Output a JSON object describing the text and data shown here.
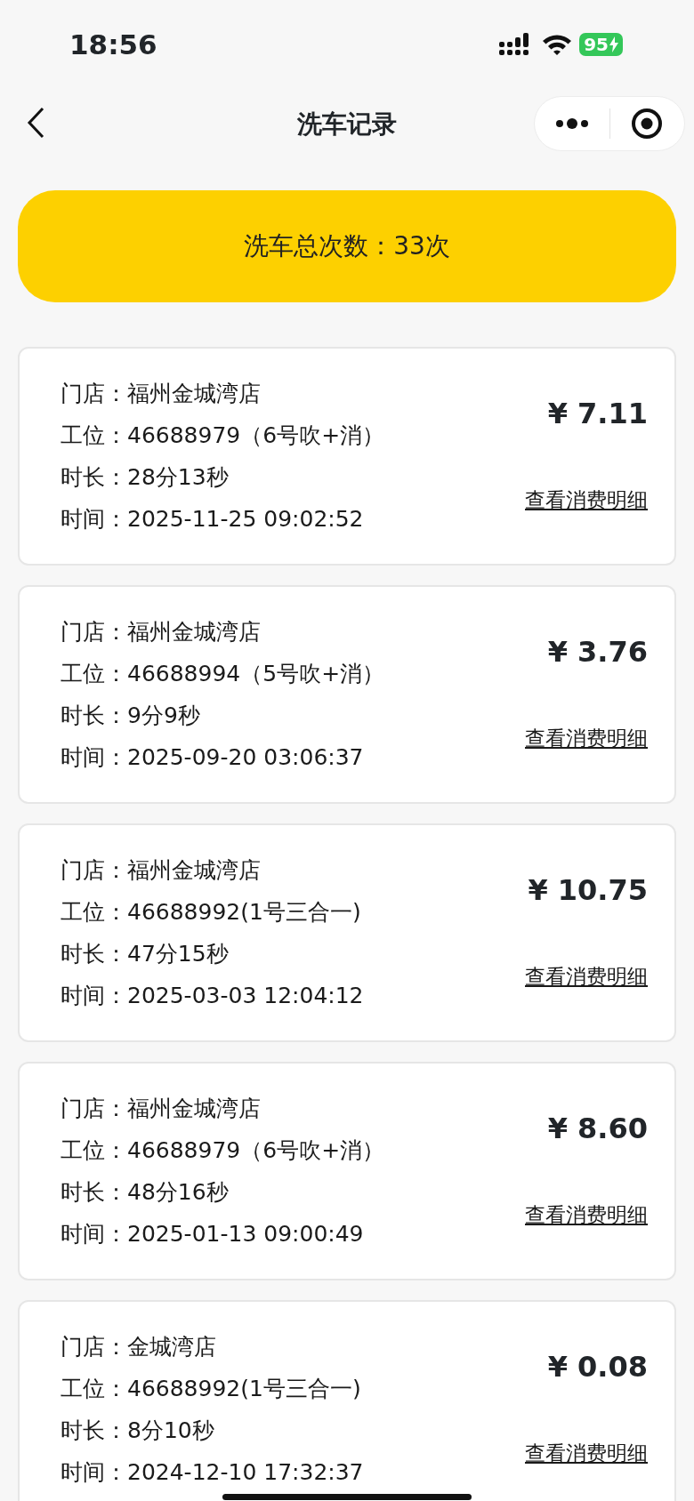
{
  "status_bar": {
    "time": "18:56",
    "battery": "95"
  },
  "nav": {
    "title": "洗车记录"
  },
  "summary": {
    "text": "洗车总次数：33次"
  },
  "records": [
    {
      "lines": [
        "门店：福州金城湾店",
        "工位：46688979（6号吹+消）",
        "时长：28分13秒",
        "时间：2025-11-25 09:02:52"
      ],
      "amount": "¥ 7.11",
      "link": "查看消费明细"
    },
    {
      "lines": [
        "门店：福州金城湾店",
        "工位：46688994（5号吹+消）",
        "时长：9分9秒",
        "时间：2025-09-20 03:06:37"
      ],
      "amount": "¥ 3.76",
      "link": "查看消费明细"
    },
    {
      "lines": [
        "门店：福州金城湾店",
        "工位：46688992(1号三合一)",
        "时长：47分15秒",
        "时间：2025-03-03 12:04:12"
      ],
      "amount": "¥ 10.75",
      "link": "查看消费明细"
    },
    {
      "lines": [
        "门店：福州金城湾店",
        "工位：46688979（6号吹+消）",
        "时长：48分16秒",
        "时间：2025-01-13 09:00:49"
      ],
      "amount": "¥ 8.60",
      "link": "查看消费明细"
    },
    {
      "lines": [
        "门店：金城湾店",
        "工位：46688992(1号三合一)",
        "时长：8分10秒",
        "时间：2024-12-10 17:32:37"
      ],
      "amount": "¥ 0.08",
      "link": "查看消费明细"
    }
  ]
}
